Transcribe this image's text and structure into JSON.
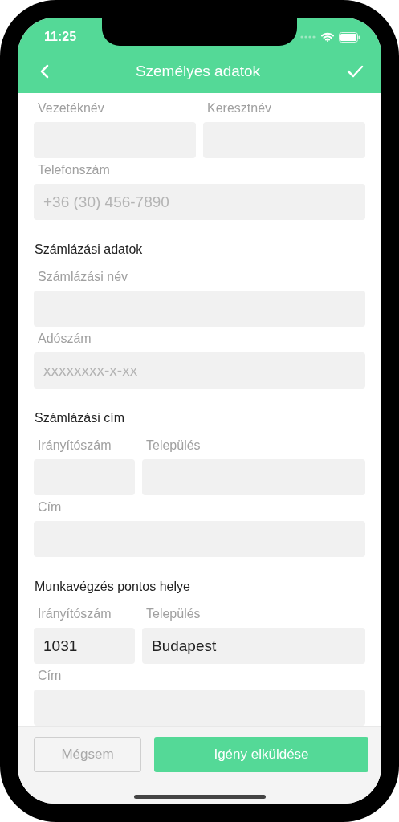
{
  "status_bar": {
    "time": "11:25"
  },
  "header": {
    "title": "Személyes adatok"
  },
  "sections": [
    {
      "rows": [
        [
          {
            "label": "Vezetéknév"
          },
          {
            "label": "Keresztnév"
          }
        ],
        [
          {
            "label": "Telefonszám",
            "placeholder": "+36 (30) 456-7890"
          }
        ]
      ]
    },
    {
      "heading": "Számlázási adatok",
      "rows": [
        [
          {
            "label": "Számlázási név"
          }
        ],
        [
          {
            "label": "Adószám",
            "placeholder": "xxxxxxxx-x-xx"
          }
        ]
      ]
    },
    {
      "heading": "Számlázási cím",
      "rows": [
        [
          {
            "label": "Irányítószám",
            "kind": "narrow"
          },
          {
            "label": "Település"
          }
        ],
        [
          {
            "label": "Cím"
          }
        ]
      ]
    },
    {
      "heading": "Munkavégzés pontos helye",
      "rows": [
        [
          {
            "label": "Irányítószám",
            "kind": "narrow",
            "value": "1031"
          },
          {
            "label": "Település",
            "value": "Budapest"
          }
        ],
        [
          {
            "label": "Cím"
          }
        ]
      ]
    }
  ],
  "footer": {
    "cancel": "Mégsem",
    "submit": "Igény elküldése"
  }
}
